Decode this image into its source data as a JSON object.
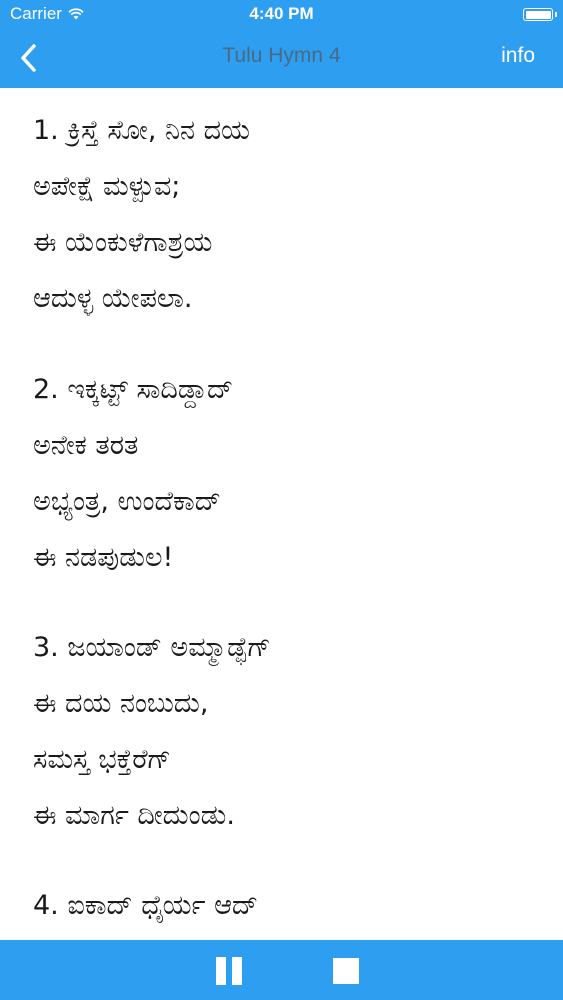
{
  "status_bar": {
    "carrier": "Carrier",
    "time": "4:40 PM",
    "icons": [
      "wifi-icon",
      "battery-icon"
    ]
  },
  "nav": {
    "back_icon": "chevron-left-icon",
    "title": "Tulu Hymn 4",
    "info_label": "info"
  },
  "hymn": {
    "stanzas": [
      [
        "1. ಕ್ರಿಸ್ತೆ ಸೋ, ನಿನ ದಯ",
        "ಅಪೇಕ್ಷೆ ಮಳ್ಪುವ;",
        "ಈ ಯೆಂಕುಳೆಗಾಶ್ರಯ",
        "ಆದುಳ್ಳ ಯೇಪಲಾ."
      ],
      [
        "2. ಇಕ್ಕಟ್ಟ್ ಸಾದಿಡ್ದಾದ್",
        "ಅನೇಕ ತರತ",
        "ಅಭ್ಯಂತ್ರ, ಉಂದೆಕಾದ್",
        "ಈ ನಡಪುಡುಲ!"
      ],
      [
        "3. ಜಯಾಂಡ್ ಅಮ್ಮಾಡ್ಫೆಗ್",
        "ಈ ದಯ ನಂಬುದು,",
        "ಸಮಸ್ತ ಭಕ್ತೆರೆಗ್",
        "ಈ ಮಾರ್ಗ ದೀದುಂಡು."
      ],
      [
        "4. ಐಕಾದ್ ಧೈರ್ಯ ಆದ್"
      ]
    ]
  },
  "toolbar": {
    "icons": [
      "pause-icon",
      "stop-icon"
    ]
  },
  "colors": {
    "accent": "#2e9ef0",
    "title_text": "#4a6a86",
    "body_text": "#1a1a1a"
  }
}
